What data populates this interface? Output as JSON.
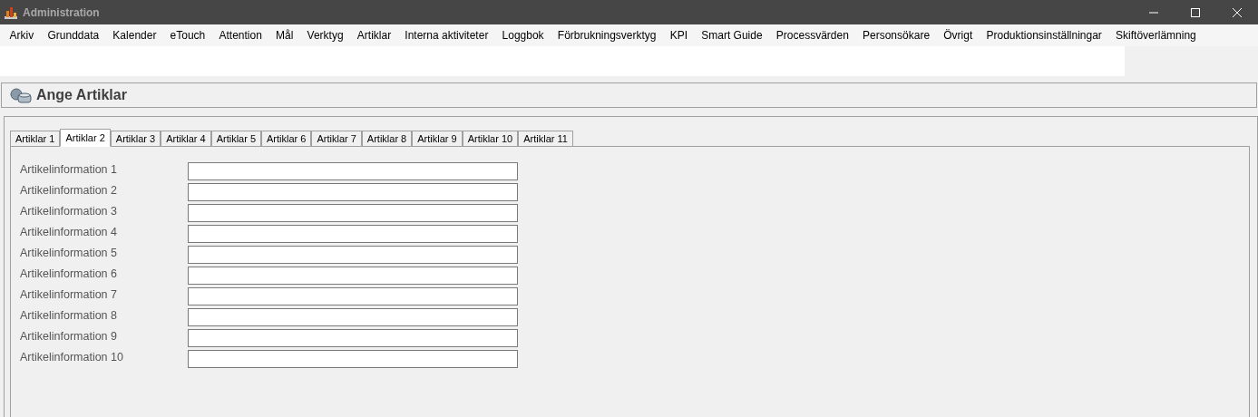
{
  "window": {
    "title": "Administration"
  },
  "menu": [
    "Arkiv",
    "Grunddata",
    "Kalender",
    "eTouch",
    "Attention",
    "Mål",
    "Verktyg",
    "Artiklar",
    "Interna aktiviteter",
    "Loggbok",
    "Förbrukningsverktyg",
    "KPI",
    "Smart Guide",
    "Processvärden",
    "Personsökare",
    "Övrigt",
    "Produktionsinställningar",
    "Skiftöverlämning"
  ],
  "header": {
    "title": "Ange Artiklar"
  },
  "tabs": [
    {
      "label": "Artiklar 1",
      "selected": false
    },
    {
      "label": "Artiklar 2",
      "selected": true
    },
    {
      "label": "Artiklar 3",
      "selected": false
    },
    {
      "label": "Artiklar 4",
      "selected": false
    },
    {
      "label": "Artiklar 5",
      "selected": false
    },
    {
      "label": "Artiklar 6",
      "selected": false
    },
    {
      "label": "Artiklar 7",
      "selected": false
    },
    {
      "label": "Artiklar 8",
      "selected": false
    },
    {
      "label": "Artiklar 9",
      "selected": false
    },
    {
      "label": "Artiklar 10",
      "selected": false
    },
    {
      "label": "Artiklar 11",
      "selected": false
    }
  ],
  "fields": [
    {
      "label": "Artikelinformation 1"
    },
    {
      "label": "Artikelinformation 2"
    },
    {
      "label": "Artikelinformation 3"
    },
    {
      "label": "Artikelinformation 4"
    },
    {
      "label": "Artikelinformation 5"
    },
    {
      "label": "Artikelinformation 6"
    },
    {
      "label": "Artikelinformation 7"
    },
    {
      "label": "Artikelinformation 8"
    },
    {
      "label": "Artikelinformation 9"
    },
    {
      "label": "Artikelinformation 10"
    }
  ]
}
